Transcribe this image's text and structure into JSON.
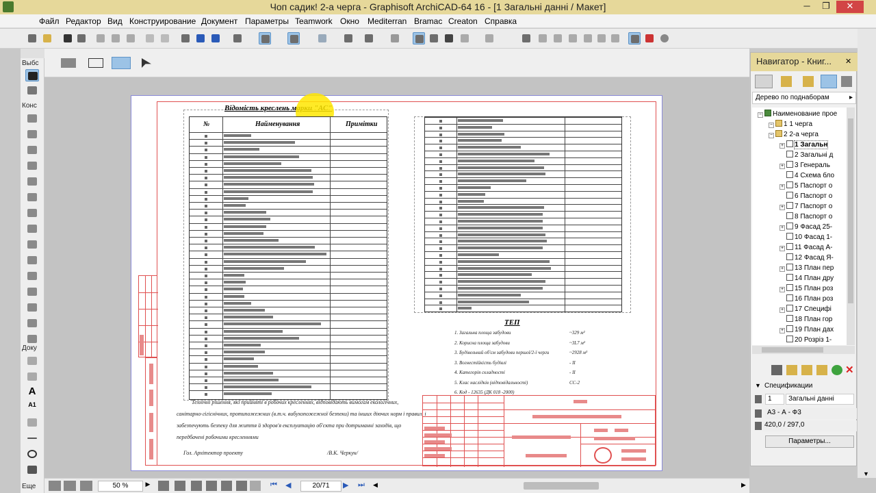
{
  "window": {
    "title": "Чоп садик! 2-а черга - Graphisoft ArchiCAD-64 16 - [1 Загальні данні / Макет]",
    "min": "─",
    "max": "❐",
    "close": "✕"
  },
  "menu": [
    "Файл",
    "Редактор",
    "Вид",
    "Конструирование",
    "Документ",
    "Параметры",
    "Teamwork",
    "Окно",
    "Mediterran",
    "Bramac",
    "Creaton",
    "Справка"
  ],
  "toolbox": {
    "select_label": "Выбс",
    "construct_label": "Конс",
    "docs_label": "Доку",
    "more_label": "Еще",
    "text_tool": "A",
    "label_tool": "A1"
  },
  "drawing": {
    "list_title": "Відомість креслень марки \"АС\"",
    "col_num": "№",
    "col_name": "Найменування",
    "col_note": "Примітки",
    "tep_title": "ТЕП",
    "tep_rows": [
      {
        "label": "1. Загальна площа забудови",
        "value": "~329 м²"
      },
      {
        "label": "2. Корисна площа забудови",
        "value": "~3L7 м²"
      },
      {
        "label": "3. Будівельний об'єм забудови першої/2-ї черги",
        "value": "~2928 м³"
      },
      {
        "label": "3. Вогнестійкість будівлі",
        "value": "- II"
      },
      {
        "label": "4. Категорія складності",
        "value": "- II"
      },
      {
        "label": "5. Клас наслідків (відповідальності)",
        "value": "СС-2"
      },
      {
        "label": "6. Код - 12635 (ДК 018 -2000)",
        "value": ""
      }
    ],
    "note_lines": [
      "Технічні рішення, які прийняті в робочих кресленнях, відповідають вимогам екологічних,",
      "санітарно-гігієнічних, протипожежних (в.т.ч. вибухопожежної безпеки) та інших діючих норм і правил, і",
      "забезпечують безпеку для життя й здоров'я експлуатацію об'єкта при дотриманні заходів, що",
      "передбачені робочими кресленнями"
    ],
    "signer_role": "Гол. Архітектор проекту",
    "signer_name": "/В.К. Черкун/"
  },
  "navigator": {
    "title": "Навигатор - Книг...",
    "view_mode": "Дерево по поднаборам",
    "tree": [
      {
        "label": "Наименование прое",
        "level": 0,
        "icon": "project"
      },
      {
        "label": "1 1 черга",
        "level": 1,
        "icon": "folder"
      },
      {
        "label": "2 2-а черга",
        "level": 1,
        "icon": "folder"
      },
      {
        "label": "1 Загальн",
        "level": 2,
        "icon": "page",
        "selected": true
      },
      {
        "label": "2 Загальні д",
        "level": 2,
        "icon": "page"
      },
      {
        "label": "3 Генераль",
        "level": 2,
        "icon": "page"
      },
      {
        "label": "4 Схема бло",
        "level": 2,
        "icon": "page"
      },
      {
        "label": "5 Паспорт о",
        "level": 2,
        "icon": "page"
      },
      {
        "label": "6 Паспорт о",
        "level": 2,
        "icon": "page"
      },
      {
        "label": "7 Паспорт о",
        "level": 2,
        "icon": "page"
      },
      {
        "label": "8 Паспорт о",
        "level": 2,
        "icon": "page"
      },
      {
        "label": "9 Фасад 25-",
        "level": 2,
        "icon": "page"
      },
      {
        "label": "10 Фасад 1-",
        "level": 2,
        "icon": "page"
      },
      {
        "label": "11 Фасад А-",
        "level": 2,
        "icon": "page"
      },
      {
        "label": "12 Фасад Я-",
        "level": 2,
        "icon": "page"
      },
      {
        "label": "13 План пер",
        "level": 2,
        "icon": "page"
      },
      {
        "label": "14 План дру",
        "level": 2,
        "icon": "page"
      },
      {
        "label": "15 План роз",
        "level": 2,
        "icon": "page"
      },
      {
        "label": "16 План роз",
        "level": 2,
        "icon": "page"
      },
      {
        "label": "17 Специфі",
        "level": 2,
        "icon": "page"
      },
      {
        "label": "18 План гор",
        "level": 2,
        "icon": "page"
      },
      {
        "label": "19 План дах",
        "level": 2,
        "icon": "page"
      },
      {
        "label": "20 Розріз 1-",
        "level": 2,
        "icon": "page"
      }
    ],
    "spec_label": "Спецификации",
    "id_value": "1",
    "name_value": "Загальні данні",
    "format_value": "А3 - А - Ф3",
    "size_value": "420,0 / 297,0",
    "params_button": "Параметры..."
  },
  "status": {
    "zoom": "50 %",
    "page": "20/71"
  },
  "colors": {
    "titlebar": "#e6d89a",
    "accent": "#9cc3e6",
    "frame_red": "#e05050"
  }
}
